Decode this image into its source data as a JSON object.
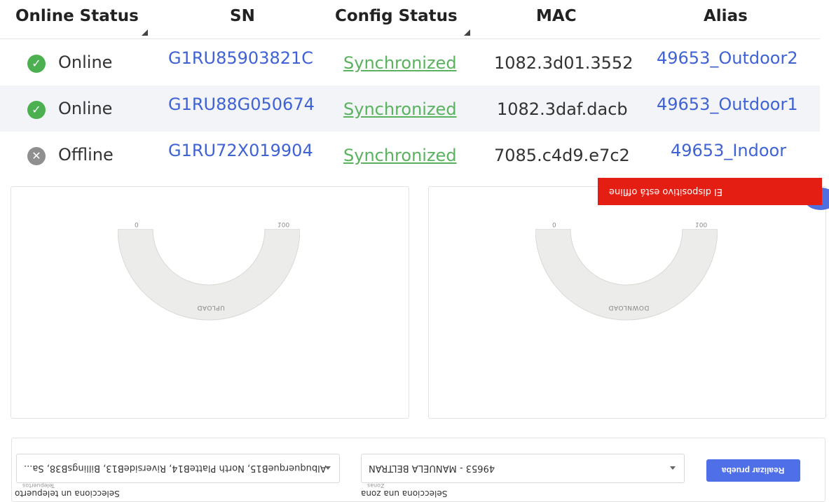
{
  "table": {
    "headers": {
      "online_status": "Online Status",
      "sn": "SN",
      "config_status": "Config Status",
      "mac": "MAC",
      "alias": "Alias"
    },
    "rows": [
      {
        "status": "Online",
        "status_icon": "check-circle-icon",
        "sn": "G1RU85903821C",
        "config": "Synchronized",
        "mac": "1082.3d01.3552",
        "alias": "49653_Outdoor2"
      },
      {
        "status": "Online",
        "status_icon": "check-circle-icon",
        "sn": "G1RU88G050674",
        "config": "Synchronized",
        "mac": "1082.3daf.dacb",
        "alias": "49653_Outdoor1"
      },
      {
        "status": "Offline",
        "status_icon": "x-circle-icon",
        "sn": "G1RU72X019904",
        "config": "Synchronized",
        "mac": "7085.c4d9.e7c2",
        "alias": "49653_Indoor"
      }
    ]
  },
  "gauges": [
    {
      "min": "0",
      "max": "100",
      "label": "UPLOAD"
    },
    {
      "min": "0",
      "max": "100",
      "label": "DOWNLOAD"
    }
  ],
  "toast": {
    "message": "El dispositivo está offline",
    "color": "#e51e14"
  },
  "controls": {
    "teleport_select": {
      "value": "AlbuquerqueB15, North PlatteB14, RiversideB13, BillingsB38, Sa...",
      "tiny_label": "Telepuertos",
      "label": "Selecciona un telepuerto"
    },
    "zone_select": {
      "value": "49653 - MANUELA BELTRAN",
      "tiny_label": "Zonas",
      "label": "Selecciona una zona"
    },
    "submit_label": "Realizar prueba"
  },
  "colors": {
    "link": "#3f62d4",
    "online": "#4caf50",
    "offline": "#8f8f8f",
    "synced": "#59b35e",
    "primary": "#4f6fe8"
  }
}
